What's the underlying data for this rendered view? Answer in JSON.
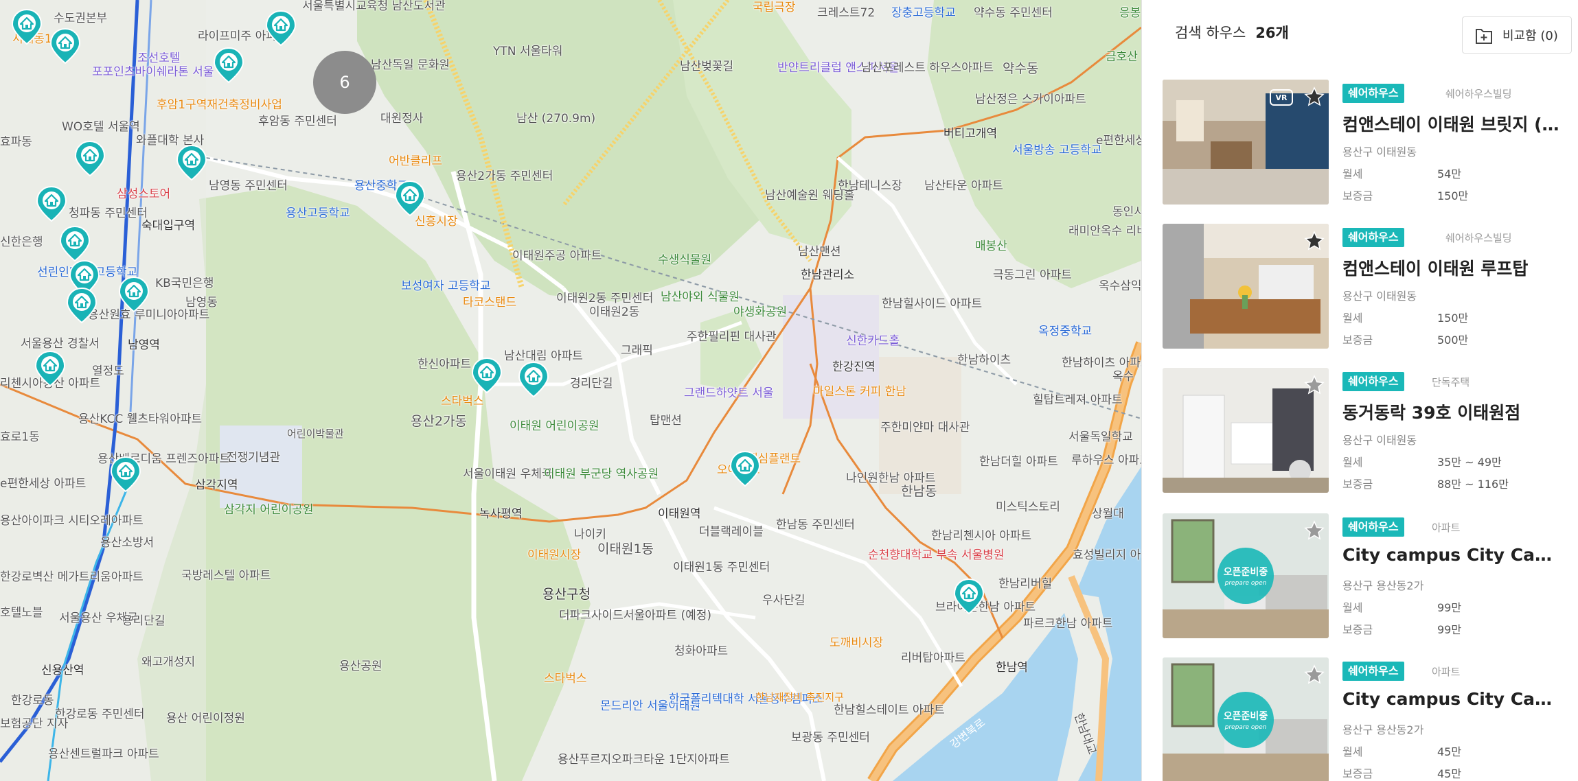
{
  "map": {
    "cluster_count": "6",
    "labels": {
      "l1": "서울특별시교육청 남산도서관",
      "l2": "수도권본부",
      "l3": "라이프미주 아파트",
      "l4": "조선호텔",
      "l5": "포포인츠바이쉐라톤 서울",
      "l6": "후암1구역재건축정비사업",
      "l7": "후암동 주민센터",
      "l8": "WO호텔 서울역",
      "l9": "와플대학 본사",
      "l10": "남영동 주민센터",
      "l11": "삼성스토어",
      "l12": "숙대입구역",
      "l13": "청파동 주민센터",
      "l14": "신한은행",
      "l15": "선린인터넷 고등학교",
      "l16": "KB국민은행",
      "l17": "남영동",
      "l18": "용산원효 루미니아아파트",
      "l19": "남영역",
      "l20": "서울용산 경찰서",
      "l21": "열정도",
      "l22": "리첸시아용산 아파트",
      "l23": "용산KCC 웰츠타워아파트",
      "l24": "효로1동",
      "l25": "용산베르디움 프렌즈아파트",
      "l26": "e편한세상 아파트",
      "l27": "삼각지역",
      "l28": "전쟁기념관",
      "l29": "어린이박물관",
      "l30": "용산아이파크 시티오레아파트",
      "l31": "삼각지 어린이공원",
      "l32": "용산소방서",
      "l33": "국방레스텔 아파트",
      "l34": "한강로벽산 메가트리움아파트",
      "l35": "서울용산 우체국",
      "l36": "용리단길",
      "l37": "호텔노블",
      "l38": "신용산역",
      "l39": "왜고개성지",
      "l40": "용산공원",
      "l41": "한강로동",
      "l42": "한강로동 주민센터",
      "l43": "용산 어린이정원",
      "l44": "용산센트럴파크 아파트",
      "l45": "보험공단 지사",
      "l46": "남산독일 문화원",
      "l47": "대원정사",
      "l48": "YTN 서울타워",
      "l49": "남산 (270.9m)",
      "l50": "어반클리프",
      "l51": "용산중학교",
      "l52": "용산고등학교",
      "l53": "용산2가동 주민센터",
      "l54": "신흥시장",
      "l55": "보성여자 고등학교",
      "l56": "타코스탠드",
      "l57": "이태원주공 아파트",
      "l58": "이태원2동 주민센터",
      "l59": "이태원2동",
      "l60": "한신아파트",
      "l61": "남산대림 아파트",
      "l62": "경리단길",
      "l63": "스타벅스",
      "l64": "용산2가동",
      "l65": "이태원 어린이공원",
      "l66": "서울이태원 우체국",
      "l67": "이태원 부군당 역사공원",
      "l68": "녹사평역",
      "l69": "나이키",
      "l70": "이태원1동",
      "l71": "이태원시장",
      "l72": "용산구청",
      "l73": "더파크사이드서울아파트 (예정)",
      "l74": "청화아파트",
      "l75": "스타벅스",
      "l76": "몬드리안 서울이태원",
      "l77": "한국폴리텍대학 서울정수캠퍼스",
      "l78": "한남재정비 촉진지구",
      "l79": "용산푸르지오파크타운 1단지아파트",
      "l80": "남산벚꽃길",
      "l81": "국립극장",
      "l82": "크레스트72",
      "l83": "장충고등학교",
      "l84": "반얀트리클럽 앤스파서울",
      "l85": "남산포레스트 하우스아파트",
      "l86": "약수동 주민센터",
      "l87": "약수동",
      "l88": "남산정은 스카이아파트",
      "l89": "버티고개역",
      "l90": "서울방송 고등학교",
      "l91": "e편한세상 파크힐스아파트",
      "l92": "남산타운 아파트",
      "l93": "한남테니스장",
      "l94": "남산예술원 웨딩홀",
      "l95": "남산맨션",
      "l96": "한남관리소",
      "l97": "수생식물원",
      "l98": "남산야외 식물원",
      "l99": "야생화공원",
      "l100": "한남힐사이드 아파트",
      "l101": "신한카드홀",
      "l102": "주한필리핀 대사관",
      "l103": "그래픽",
      "l104": "그랜드하얏트 서울",
      "l105": "탑맨션",
      "l106": "한강진역",
      "l107": "마일스톤 커피 한남",
      "l108": "주한미얀마 대사관",
      "l109": "맥심플랜트",
      "l110": "나인원한남 아파트",
      "l111": "한남동",
      "l112": "오아시스",
      "l113": "이태원역",
      "l114": "더블랙레이블",
      "l115": "한남동 주민센터",
      "l116": "이태원1동 주민센터",
      "l117": "우사단길",
      "l118": "순천향대학교 부속 서울병원",
      "l119": "도깨비시장",
      "l120": "한남리첸시아 아파트",
      "l121": "한남리버힐",
      "l122": "브라이튼한남 아파트",
      "l123": "파르크한남 아파트",
      "l124": "리버탑아파트",
      "l125": "한남역",
      "l126": "한남힐스테이트 아파트",
      "l127": "보광동 주민센터",
      "l128": "미스틱스토리",
      "l129": "효성빌리지 아파트",
      "l130": "상월대",
      "l131": "한남더힐 아파트",
      "l132": "루하우스 아파트",
      "l133": "서울독일학교",
      "l134": "힐탑트레져 아파트",
      "l135": "한남하이츠 아파트",
      "l136": "한남하이츠",
      "l137": "옥수",
      "l138": "옥정중학교",
      "l139": "극동그린 아파트",
      "l140": "매봉산",
      "l141": "래미안옥수 리버젠아파트",
      "l142": "동인시",
      "l143": "옥수삼익 아파트",
      "l144": "금호산",
      "l145": "응봉",
      "l146": "강변북로",
      "l147": "한남대교",
      "l148": "서계동1구역",
      "l149": "효파동"
    }
  },
  "panel": {
    "result_label": "검색 하우스",
    "result_count": "26개",
    "compare_label": "비교함 (0)",
    "listings": [
      {
        "badge": "쉐어하우스",
        "building": "쉐어하우스빌딩",
        "name": "컴앤스테이 이태원 브릿지 (B…",
        "location": "용산구 이태원동",
        "rent_label": "월세",
        "rent": "54만",
        "deposit_label": "보증금",
        "deposit": "150만",
        "vr": "VR",
        "starred": true
      },
      {
        "badge": "쉐어하우스",
        "building": "쉐어하우스빌딩",
        "name": "컴앤스테이 이태원 루프탑",
        "location": "용산구 이태원동",
        "rent_label": "월세",
        "rent": "150만",
        "deposit_label": "보증금",
        "deposit": "500만",
        "starred": true
      },
      {
        "badge": "쉐어하우스",
        "building": "단독주택",
        "name": "동거동락 39호 이태원점",
        "location": "용산구 이태원동",
        "rent_label": "월세",
        "rent": "35만 ~ 49만",
        "deposit_label": "보증금",
        "deposit": "88만 ~ 116만",
        "starred": false
      },
      {
        "badge": "쉐어하우스",
        "building": "아파트",
        "name": "City campus City Campus …",
        "location": "용산구 용산동2가",
        "rent_label": "월세",
        "rent": "99만",
        "deposit_label": "보증금",
        "deposit": "99만",
        "open_badge": "오픈준비중",
        "open_sub": "prepare open",
        "starred": false
      },
      {
        "badge": "쉐어하우스",
        "building": "아파트",
        "name": "City campus City Campus …",
        "location": "용산구 용산동2가",
        "rent_label": "월세",
        "rent": "45만",
        "deposit_label": "보증금",
        "deposit": "45만",
        "open_badge": "오픈준비중",
        "open_sub": "prepare open",
        "starred": false
      }
    ]
  }
}
